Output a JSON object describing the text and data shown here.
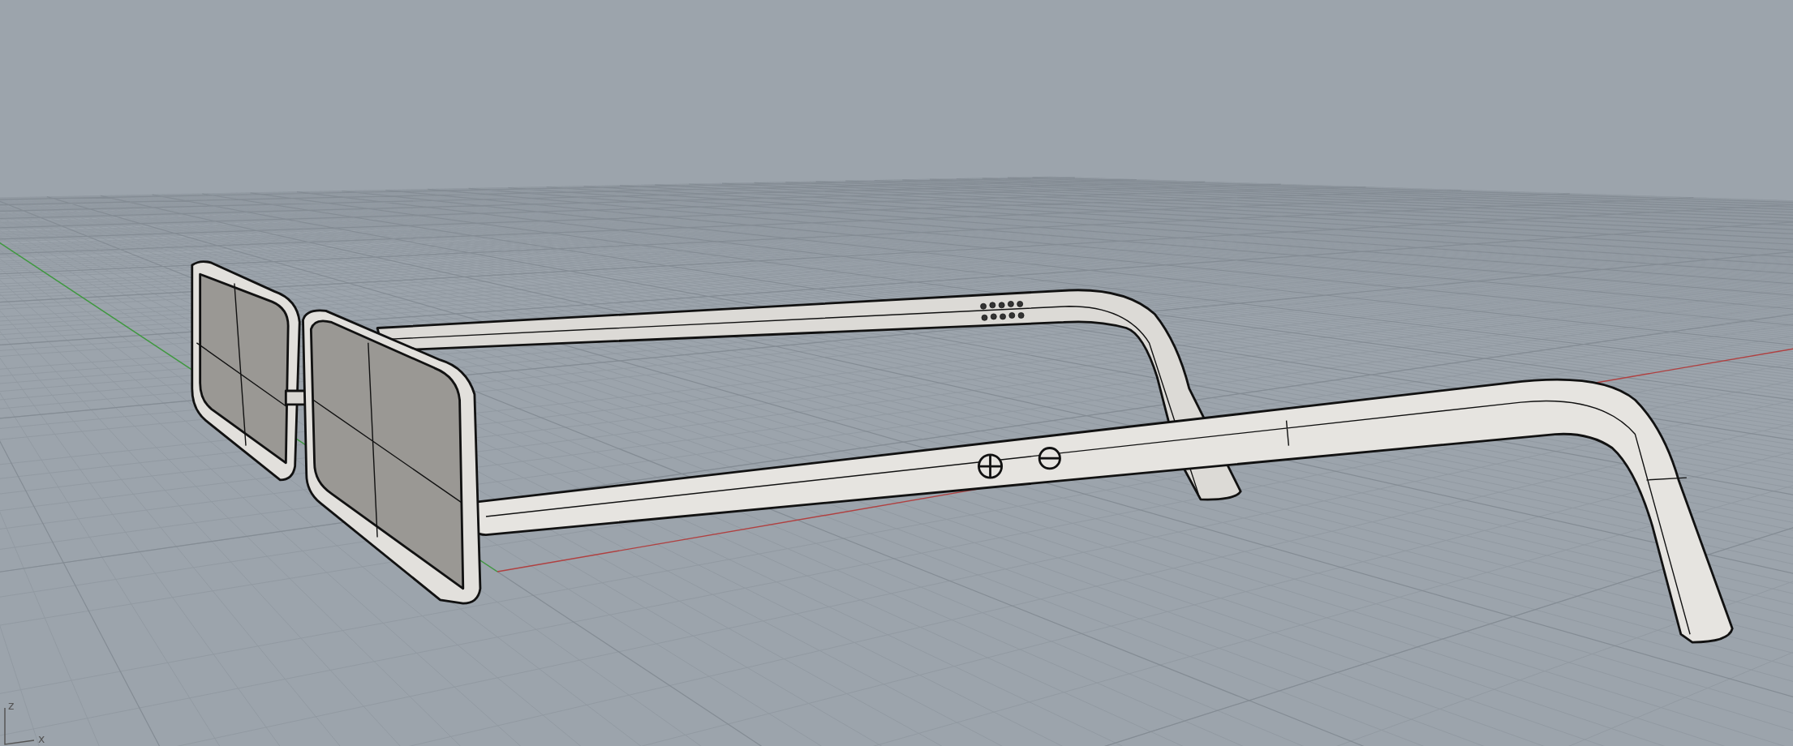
{
  "viewport": {
    "axis_widget": {
      "z_label": "z",
      "x_label": "x"
    }
  }
}
